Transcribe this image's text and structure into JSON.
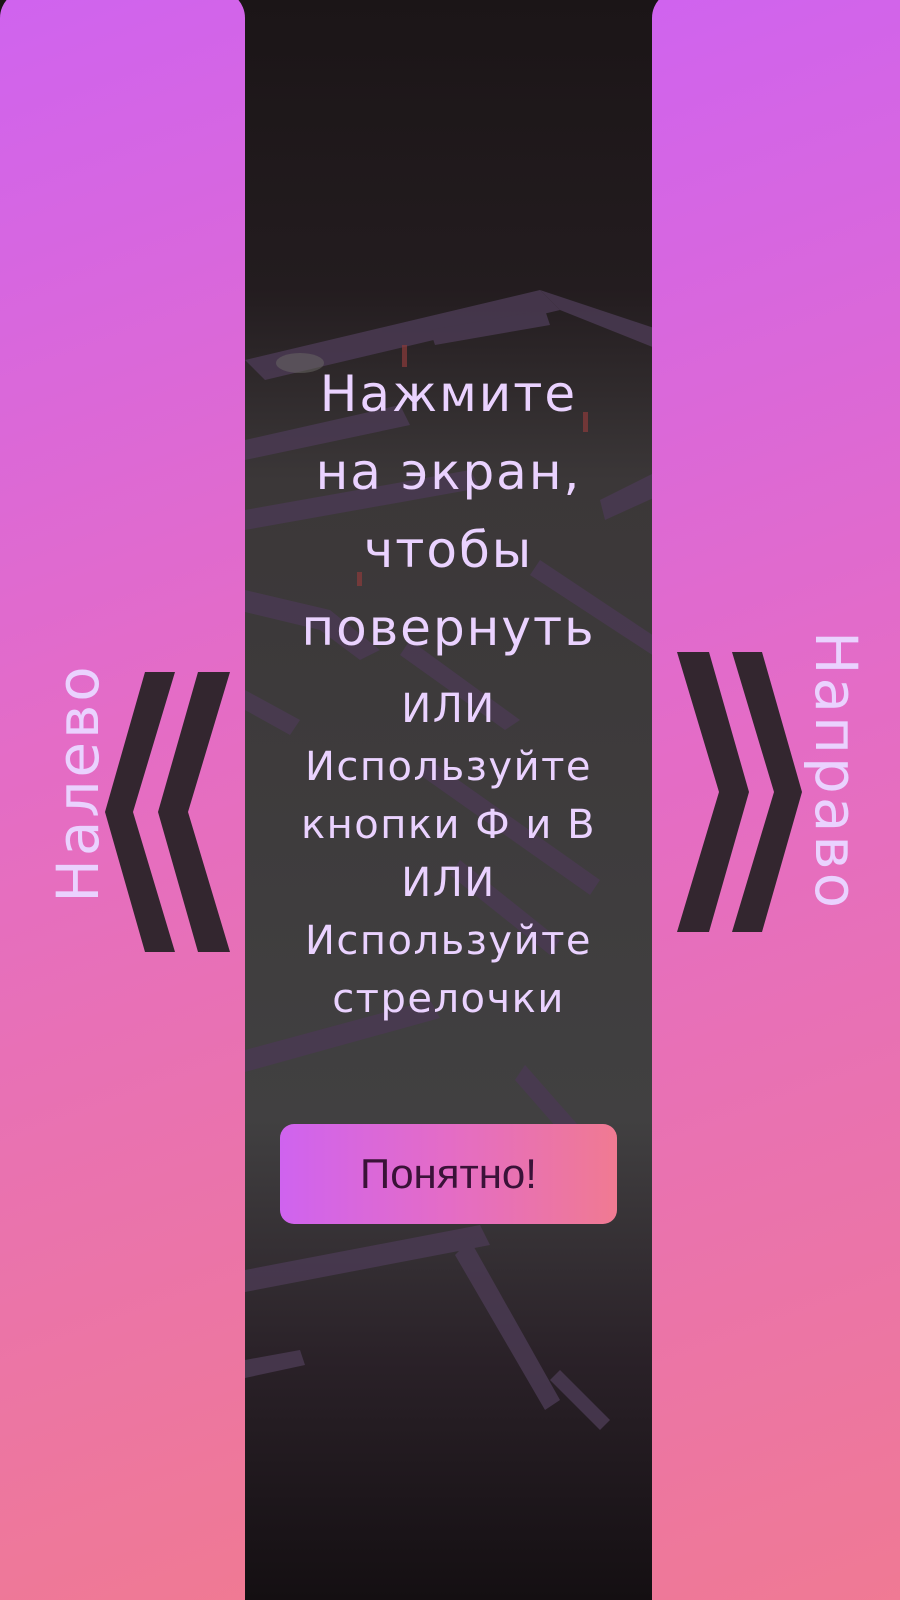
{
  "left_control": {
    "label": "Налево",
    "icon": "double-chevron-left-icon"
  },
  "right_control": {
    "label": "Направо",
    "icon": "double-chevron-right-icon"
  },
  "instructions": {
    "lines": [
      "Нажмите",
      "на экран,",
      "чтобы",
      "повернуть"
    ]
  },
  "alternatives": {
    "lines": [
      "ИЛИ",
      "Используйте",
      "кнопки Ф и В",
      "ИЛИ",
      "Используйте",
      "стрелочки"
    ]
  },
  "confirm_button": {
    "label": "Понятно!"
  },
  "colors": {
    "panel_gradient_start": "#cf63ef",
    "panel_gradient_end": "#f07a92",
    "text_light": "#ead2ff",
    "chevron": "#33262f",
    "button_text": "#3a1238"
  }
}
